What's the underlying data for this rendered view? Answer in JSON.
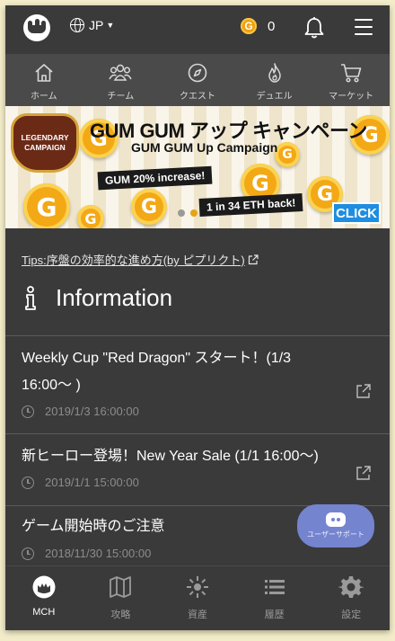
{
  "header": {
    "language": "JP",
    "coin_symbol": "G",
    "coin_count": "0"
  },
  "nav": [
    {
      "label": "ホーム",
      "icon": "home-icon"
    },
    {
      "label": "チーム",
      "icon": "team-icon"
    },
    {
      "label": "クエスト",
      "icon": "compass-icon"
    },
    {
      "label": "デュエル",
      "icon": "flame-icon"
    },
    {
      "label": "マーケット",
      "icon": "cart-icon"
    }
  ],
  "banner": {
    "emblem_line1": "LEGENDARY",
    "emblem_line2": "CAMPAIGN",
    "title": "GUM GUM アップ キャンペーン",
    "subtitle": "GUM GUM Up Campaign",
    "tag1": "GUM 20% increase!",
    "tag2": "1 in 34 ETH back!",
    "click": "CLICK",
    "coin_letter": "G"
  },
  "tips": "Tips:序盤の効率的な進め方(by ピプリクト)",
  "information": {
    "title": "Information",
    "items": [
      {
        "title": "Weekly Cup \"Red Dragon\" スタート！(1/3 16:00〜 )",
        "date": "2019/1/3 16:00:00"
      },
      {
        "title": "新ヒーロー登場！New Year Sale (1/1 16:00〜)",
        "date": "2019/1/1 15:00:00"
      },
      {
        "title": "ゲーム開始時のご注意",
        "date": "2018/11/30 15:00:00"
      }
    ]
  },
  "support": "ユーザーサポート",
  "tabs": [
    {
      "label": "MCH",
      "icon": "mch-logo-icon"
    },
    {
      "label": "攻略",
      "icon": "map-icon"
    },
    {
      "label": "資産",
      "icon": "asset-icon"
    },
    {
      "label": "履歴",
      "icon": "list-icon"
    },
    {
      "label": "設定",
      "icon": "gear-icon"
    }
  ],
  "colors": {
    "background": "#3a3a3a",
    "navbar": "#4a4a4a",
    "accent": "#f3a815",
    "support": "#7584cf"
  }
}
